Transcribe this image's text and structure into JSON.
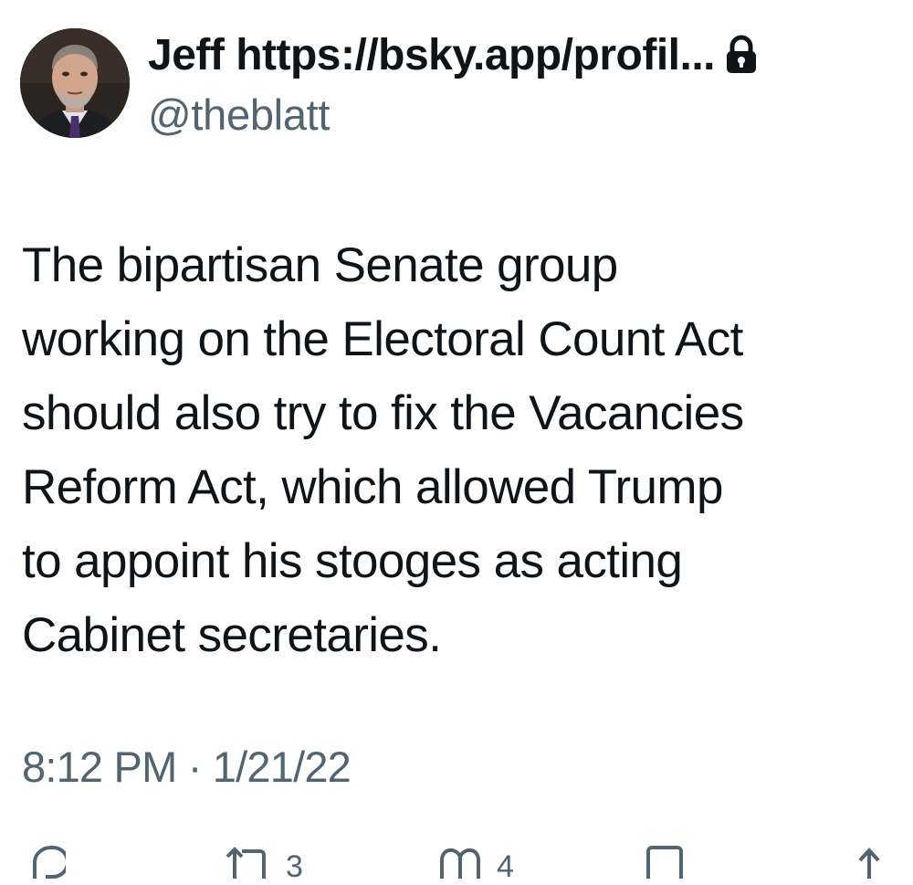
{
  "author": {
    "display_name": "Jeff https://bsky.app/profil...",
    "handle": "@theblatt",
    "avatar_icon": "profile-photo",
    "protected_icon": "lock-icon"
  },
  "tweet": {
    "text_lines": [
      "The bipartisan Senate group",
      "working on the Electoral Count Act",
      "should also try to fix the Vacancies",
      "Reform Act, which allowed Trump",
      "to appoint his stooges as acting",
      "Cabinet secretaries."
    ],
    "timestamp": "8:12 PM · 1/21/22"
  },
  "actions": {
    "reply_icon": "reply-icon",
    "retweet_icon": "retweet-icon",
    "retweet_count": "3",
    "like_icon": "heart-icon",
    "like_count": "4",
    "bookmark_icon": "bookmark-icon",
    "share_icon": "share-icon"
  },
  "colors": {
    "text_primary": "#0f1419",
    "text_secondary": "#536471",
    "background": "#ffffff"
  }
}
